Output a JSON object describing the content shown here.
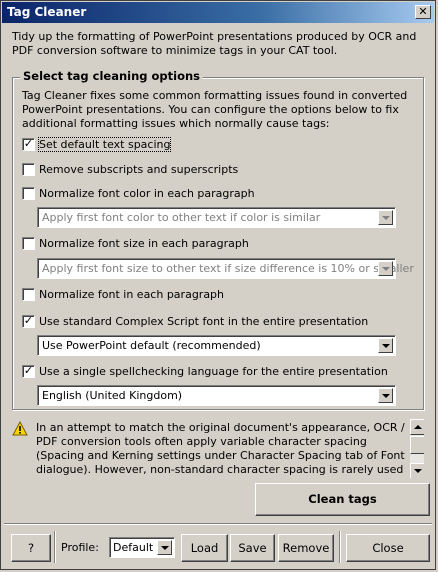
{
  "window": {
    "title": "Tag Cleaner",
    "close_glyph": "✕"
  },
  "intro": "Tidy up the formatting of PowerPoint presentations produced by OCR and PDF conversion software to minimize tags in your CAT tool.",
  "options": {
    "group_title": "Select tag cleaning options",
    "description": "Tag Cleaner fixes some common formatting issues found in converted PowerPoint presentations. You can configure the options below to fix additional formatting issues which normally cause tags:",
    "items": [
      {
        "label": "Set default text spacing",
        "checked": true
      },
      {
        "label": "Remove subscripts and superscripts",
        "checked": false
      },
      {
        "label": "Normalize font color in each paragraph",
        "checked": false
      },
      {
        "label": "Normalize font size in each paragraph",
        "checked": false
      },
      {
        "label": "Normalize font in each paragraph",
        "checked": false
      },
      {
        "label": "Use standard Complex Script font in the entire presentation",
        "checked": true
      },
      {
        "label": "Use a single spellchecking language for the entire presentation",
        "checked": true
      }
    ],
    "font_color_select": "Apply first font color to other text if color is similar",
    "font_size_select": "Apply first font size to other text if size difference is 10% or smaller",
    "complex_script_select": "Use PowerPoint default (recommended)",
    "language_select": "English (United Kingdom)",
    "check_glyph": "✓"
  },
  "info": {
    "icon": "warning-icon",
    "text": "In an attempt to match the original document's appearance, OCR / PDF conversion tools often apply variable character spacing (Spacing and Kerning settings under Character Spacing tab of Font dialogue). However, non-standard character spacing is rarely used in regular PowerPoint presentations and causes tags."
  },
  "buttons": {
    "clean": "Clean tags",
    "help": "?",
    "profile_label": "Profile:",
    "profile_value": "Default",
    "load": "Load",
    "save": "Save",
    "remove": "Remove",
    "close": "Close"
  }
}
